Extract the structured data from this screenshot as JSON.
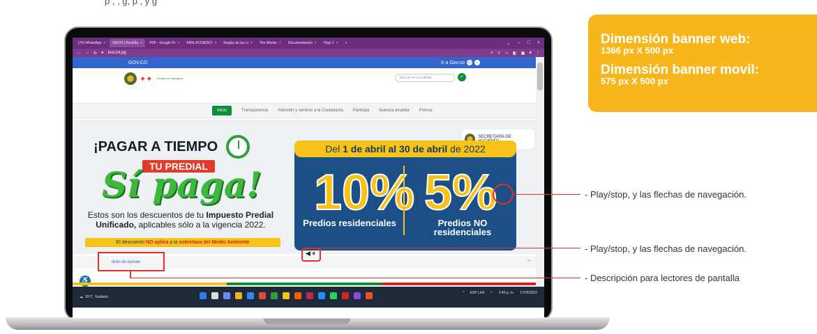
{
  "page": {
    "top_text": "p , ,  g,  p , y               g"
  },
  "browser": {
    "tabs": [
      {
        "label": "(70) WhatsApp",
        "active": false
      },
      {
        "label": "INICIO | Alcaldía",
        "active": true
      },
      {
        "label": "PDF - Google Dr",
        "active": false
      },
      {
        "label": "AIRE ACONDICI",
        "active": false
      },
      {
        "label": "Reglas de las ci",
        "active": false
      },
      {
        "label": "The Weekn",
        "active": false
      },
      {
        "label": "Documentación",
        "active": false
      },
      {
        "label": "Flujo 1",
        "active": false
      }
    ],
    "address": "test.int.pg"
  },
  "site": {
    "gov_label": "GOV.CO",
    "ir_label": "Ir a Gov.co",
    "search_placeholder": "Buscar en la entidad",
    "logo_text": "Ciudad de Cartagena",
    "nav": [
      "Inicio",
      "Transparencia",
      "Atención y servicio a la Ciudadanía",
      "Participa",
      "Nuestra alcaldía",
      "Prensa"
    ],
    "banner": {
      "pagar": "¡PAGAR A TIEMPO",
      "predial": "TU PREDIAL",
      "sipaga": "Sí paga!",
      "desc_pre": "Estos son los descuentos de tu ",
      "desc_bold": "Impuesto Predial Unificado,",
      "desc_post": " aplicables sólo a la vigencia 2022.",
      "noaplica_pre": "El descuento ",
      "noaplica_bold1": "NO aplica",
      "noaplica_mid": " a la ",
      "noaplica_bold2": "sobretasa del Medio Ambiente",
      "promo_head_pre": "Del ",
      "promo_head_bold": "1 de abril al 30 de abril",
      "promo_head_post": " de 2022",
      "pct1": "10%",
      "pct1_caption": "Predios residenciales",
      "pct2": "5%",
      "pct2_caption": "Predios NO residenciales",
      "hacienda": "SECRETARÍA DE HACIENDA"
    },
    "title_label": "titulo de banner",
    "play_controls": "◀ ⏸"
  },
  "taskbar": {
    "weather_temp": "30°C",
    "weather_desc": "Nublado",
    "lang": "ESP LAA",
    "time": "2:40 p. m.",
    "date": "17/05/2022"
  },
  "annotations": {
    "banner_web_title": "Dimensión banner web:",
    "banner_web_size": "1366 px X 500 px",
    "banner_movil_title": "Dimensión banner movil:",
    "banner_movil_size": "575 px X 500 px",
    "ann1": "- Play/stop, y las flechas de navegación.",
    "ann2": "- Play/stop, y las flechas de navegación.",
    "ann3": "- Descripción para lectores de pantalla"
  },
  "colors": {
    "accent": "#f7b71c",
    "annotation": "#e0312c",
    "gov_blue": "#3366cc",
    "green": "#138a3e"
  }
}
